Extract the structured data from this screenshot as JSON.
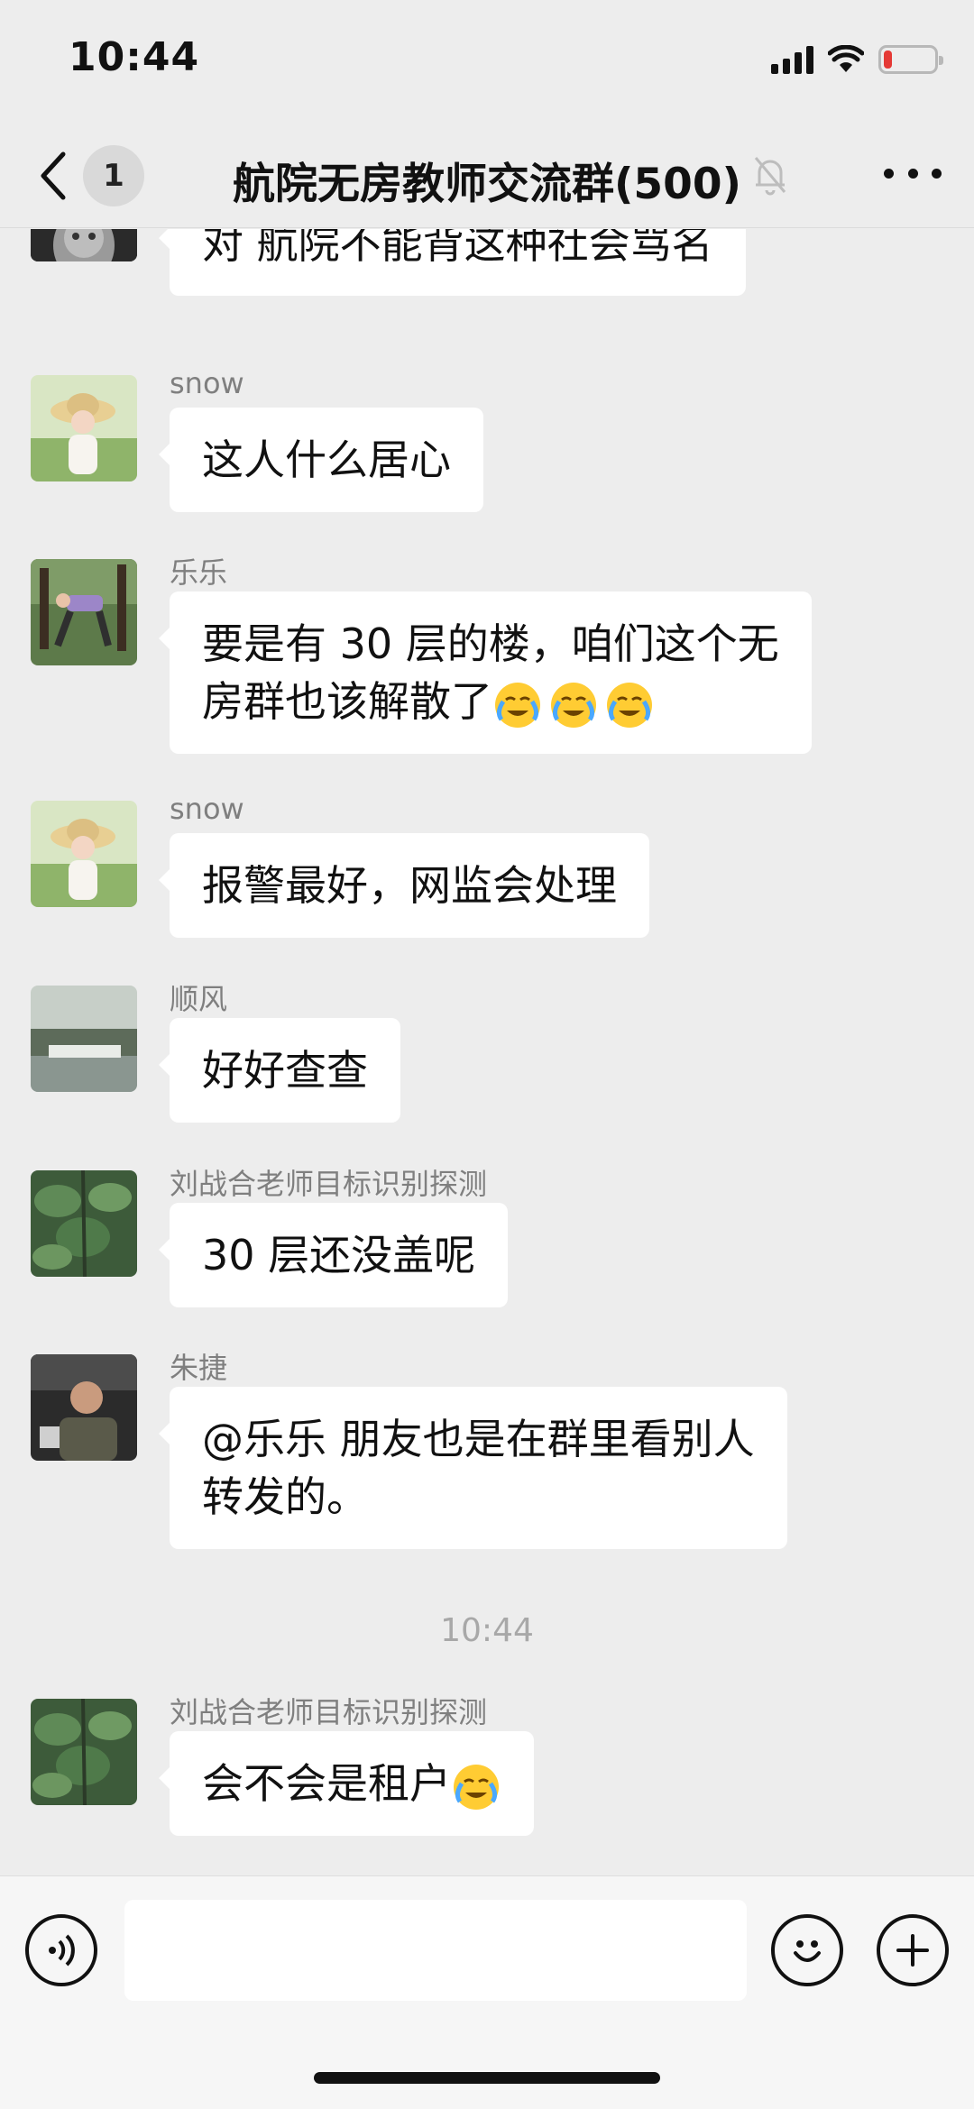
{
  "status_bar": {
    "time": "10:44",
    "battery_level": 0.15
  },
  "nav": {
    "unread_count": "1",
    "title": "航院无房教师交流群(500)"
  },
  "messages": [
    {
      "sender": "",
      "text": "对 航院不能背这种社会骂名",
      "avatar": "cat-avatar"
    },
    {
      "sender": "snow",
      "text": "这人什么居心",
      "avatar": "girl-straw-hat-avatar"
    },
    {
      "sender": "乐乐",
      "text_line1": "要是有 30 层的楼，咱们这个无",
      "text_line2": "房群也该解散了",
      "emoji_count": 3,
      "emoji": "face-with-tears-icon",
      "avatar": "outdoor-person-avatar"
    },
    {
      "sender": "snow",
      "text": "报警最好，网监会处理",
      "avatar": "girl-straw-hat-avatar"
    },
    {
      "sender": "顺风",
      "text": "好好查查",
      "avatar": "landscape-avatar"
    },
    {
      "sender": "刘战合老师目标识别探测",
      "text": "30 层还没盖呢",
      "avatar": "leaves-avatar"
    },
    {
      "sender": "朱捷",
      "text_line1": "@乐乐 朋友也是在群里看别人",
      "text_line2": "转发的。",
      "avatar": "man-avatar"
    },
    {
      "sender": "刘战合老师目标识别探测",
      "text": "会不会是租户",
      "emoji": "face-with-tears-icon",
      "avatar": "leaves-avatar"
    }
  ],
  "time_separator": "10:44",
  "colors": {
    "background": "#ededed",
    "bubble": "#ffffff",
    "sender": "#7f7f7f",
    "battery_low": "#e53935"
  }
}
